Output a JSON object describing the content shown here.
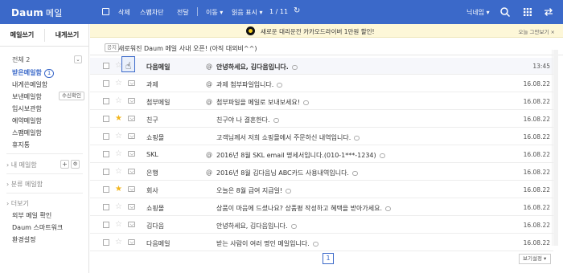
{
  "header": {
    "logo": "Daum",
    "app": "메일",
    "toolbar": {
      "delete": "삭제",
      "spam": "스팸차단",
      "forward": "전달",
      "move": "이동",
      "read": "읽음 표시",
      "page": "1 / 11"
    },
    "user": "닉네임",
    "icons": [
      "checkbox-icon",
      "refresh-icon",
      "search-icon",
      "grid-icon",
      "arrows-icon"
    ]
  },
  "sidebar": {
    "compose": "메일쓰기",
    "compose_self": "내게쓰기",
    "all": "전체 2",
    "folders": [
      {
        "label": "받은메일함",
        "count": "1"
      },
      {
        "label": "내게쓴메일함"
      },
      {
        "label": "보낸메일함",
        "action": "수신확인"
      },
      {
        "label": "임시보관함"
      },
      {
        "label": "예약메일함"
      },
      {
        "label": "스팸메일함"
      },
      {
        "label": "휴지통"
      }
    ],
    "my_folders": "› 내 메일함",
    "categories": "› 분류 메일함",
    "more": "› 더보기",
    "extras": [
      "외부 메일 확인",
      "Daum 스마트워크",
      "환경설정"
    ]
  },
  "banner": {
    "text": "새로운 대리운전 카카오드라이버 1만원 할인!",
    "close": "오늘 그만보기 ×"
  },
  "notice": {
    "tag": "공지",
    "text": "새로워진 Daum 메일 사내 오픈! (아직 대외비^^)"
  },
  "emails": [
    {
      "sender": "다음메일",
      "attach": true,
      "subject": "안녕하세요, 김다음입니다.",
      "date": "13:45",
      "starred": false,
      "unread": true
    },
    {
      "sender": "과제",
      "attach": true,
      "subject": "과제 첨부파일입니다.",
      "date": "16.08.22",
      "starred": false,
      "unread": false
    },
    {
      "sender": "첨부메일",
      "attach": true,
      "subject": "첨부파일을 메일로 보내보세요!",
      "date": "16.08.22",
      "starred": false,
      "unread": false
    },
    {
      "sender": "친구",
      "attach": false,
      "subject": "친구야 나 결혼한다.",
      "date": "16.08.22",
      "starred": true,
      "unread": false
    },
    {
      "sender": "쇼핑몰",
      "attach": false,
      "subject": "고객님께서 저희 쇼핑몰에서 주문하신 내역입니다.",
      "date": "16.08.22",
      "starred": false,
      "unread": false
    },
    {
      "sender": "SKL",
      "attach": true,
      "subject": "2016년 8월 SKL email 명세서입니다.(010-1***-1234)",
      "date": "16.08.22",
      "starred": false,
      "unread": false
    },
    {
      "sender": "은행",
      "attach": true,
      "subject": "2016년 8월 김다음님 ABC카드 사용내역입니다.",
      "date": "16.08.22",
      "starred": false,
      "unread": false
    },
    {
      "sender": "회사",
      "attach": false,
      "subject": "오늘은 8월 급여 지급일!",
      "date": "16.08.22",
      "starred": true,
      "unread": false
    },
    {
      "sender": "쇼핑몰",
      "attach": false,
      "subject": "상품이 마음에 드셨나요? 상품평 작성하고 혜택을 받아가세요.",
      "date": "16.08.22",
      "starred": false,
      "unread": false
    },
    {
      "sender": "김다음",
      "attach": false,
      "subject": "안녕하세요, 김다음입니다.",
      "date": "16.08.22",
      "starred": false,
      "unread": false
    },
    {
      "sender": "다음메일",
      "attach": false,
      "subject": "받는 사람이 여러 명인 메일입니다.",
      "date": "16.08.22",
      "starred": false,
      "unread": false
    }
  ],
  "pagination": {
    "current": "1"
  },
  "view_settings": "보기설정 ▾",
  "colors": {
    "accent": "#3b69c9",
    "star": "#f2b51c",
    "banner_bg": "#fdf7d8"
  }
}
